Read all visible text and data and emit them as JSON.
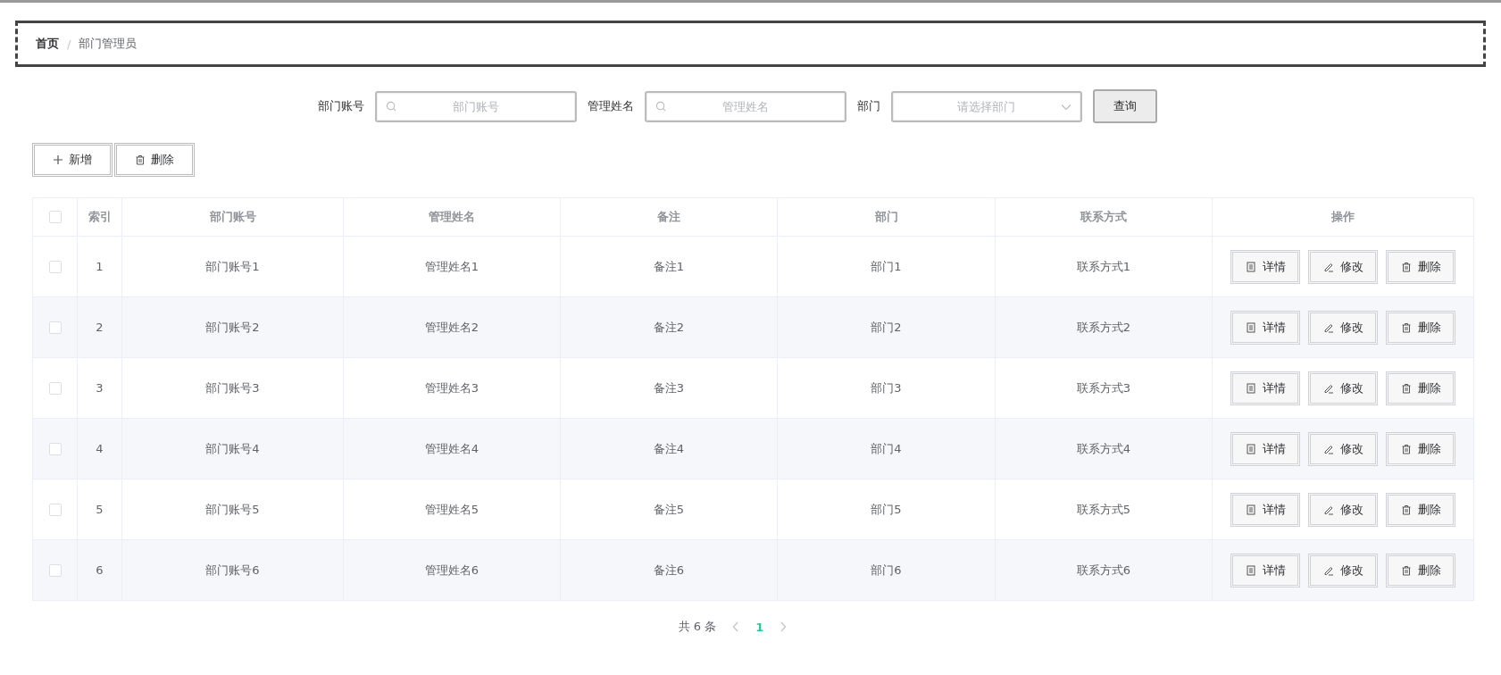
{
  "breadcrumb": [
    {
      "label": "首页",
      "current": false
    },
    {
      "label": "部门管理员",
      "current": true
    }
  ],
  "breadcrumb_separator": "/",
  "search": {
    "fields": [
      {
        "kind": "input",
        "label": "部门账号",
        "placeholder": "部门账号"
      },
      {
        "kind": "input",
        "label": "管理姓名",
        "placeholder": "管理姓名"
      },
      {
        "kind": "select",
        "label": "部门",
        "placeholder": "请选择部门"
      }
    ],
    "button": "查询"
  },
  "toolbar": [
    {
      "kind": "add",
      "label": "新增"
    },
    {
      "kind": "delete",
      "label": "删除"
    }
  ],
  "table": {
    "columns": [
      "索引",
      "部门账号",
      "管理姓名",
      "备注",
      "部门",
      "联系方式",
      "操作"
    ],
    "rows": [
      {
        "checked": false,
        "cells": [
          "1",
          "部门账号1",
          "管理姓名1",
          "备注1",
          "部门1",
          "联系方式1"
        ],
        "actions": [
          {
            "kind": "detail",
            "label": "详情"
          },
          {
            "kind": "edit",
            "label": "修改"
          },
          {
            "kind": "delete",
            "label": "删除"
          }
        ]
      },
      {
        "checked": false,
        "cells": [
          "2",
          "部门账号2",
          "管理姓名2",
          "备注2",
          "部门2",
          "联系方式2"
        ],
        "actions": [
          {
            "kind": "detail",
            "label": "详情"
          },
          {
            "kind": "edit",
            "label": "修改"
          },
          {
            "kind": "delete",
            "label": "删除"
          }
        ]
      },
      {
        "checked": false,
        "cells": [
          "3",
          "部门账号3",
          "管理姓名3",
          "备注3",
          "部门3",
          "联系方式3"
        ],
        "actions": [
          {
            "kind": "detail",
            "label": "详情"
          },
          {
            "kind": "edit",
            "label": "修改"
          },
          {
            "kind": "delete",
            "label": "删除"
          }
        ]
      },
      {
        "checked": false,
        "cells": [
          "4",
          "部门账号4",
          "管理姓名4",
          "备注4",
          "部门4",
          "联系方式4"
        ],
        "actions": [
          {
            "kind": "detail",
            "label": "详情"
          },
          {
            "kind": "edit",
            "label": "修改"
          },
          {
            "kind": "delete",
            "label": "删除"
          }
        ]
      },
      {
        "checked": false,
        "cells": [
          "5",
          "部门账号5",
          "管理姓名5",
          "备注5",
          "部门5",
          "联系方式5"
        ],
        "actions": [
          {
            "kind": "detail",
            "label": "详情"
          },
          {
            "kind": "edit",
            "label": "修改"
          },
          {
            "kind": "delete",
            "label": "删除"
          }
        ]
      },
      {
        "checked": false,
        "cells": [
          "6",
          "部门账号6",
          "管理姓名6",
          "备注6",
          "部门6",
          "联系方式6"
        ],
        "actions": [
          {
            "kind": "detail",
            "label": "详情"
          },
          {
            "kind": "edit",
            "label": "修改"
          },
          {
            "kind": "delete",
            "label": "删除"
          }
        ]
      }
    ],
    "header_checked": false
  },
  "pagination": {
    "total": "共 6 条",
    "pages": [
      {
        "label": "1",
        "selected": true
      }
    ]
  }
}
